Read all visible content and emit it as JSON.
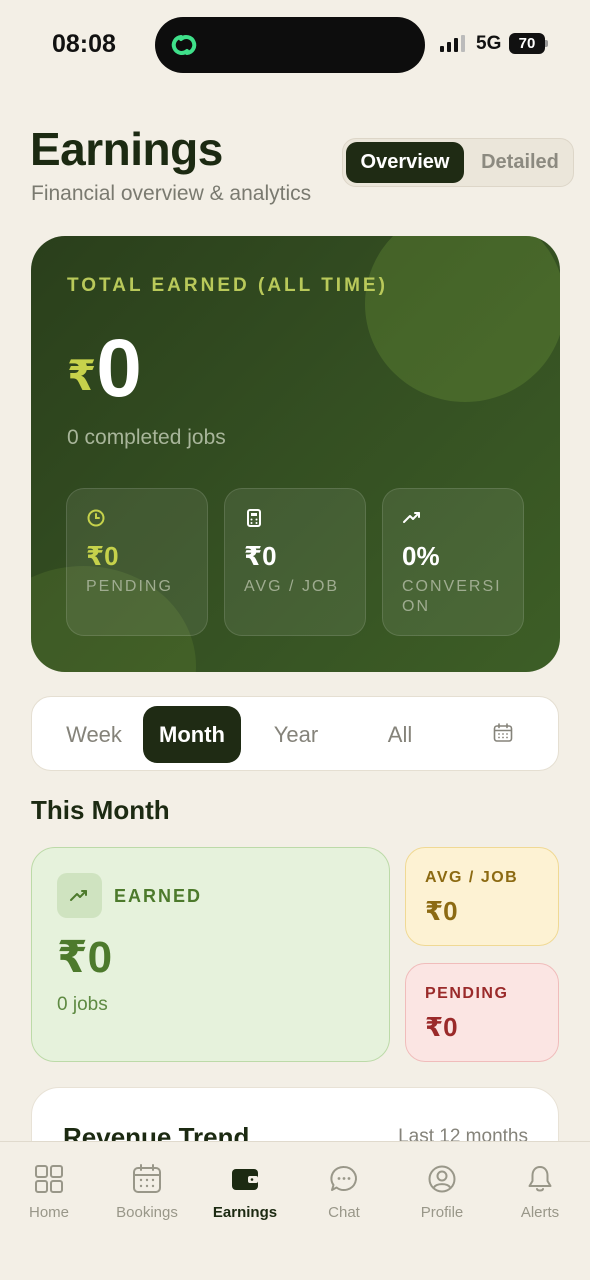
{
  "status_bar": {
    "time": "08:08",
    "network": "5G",
    "battery": "70"
  },
  "header": {
    "title": "Earnings",
    "subtitle": "Financial overview & analytics",
    "view_toggle": [
      "Overview",
      "Detailed"
    ]
  },
  "hero": {
    "label": "TOTAL EARNED (ALL TIME)",
    "currency": "₹",
    "amount": "0",
    "jobs": "0 completed jobs",
    "stats": [
      {
        "icon": "clock-icon",
        "value": "₹0",
        "label": "PENDING"
      },
      {
        "icon": "calculator-icon",
        "value": "₹0",
        "label": "AVG / JOB"
      },
      {
        "icon": "trending-up-icon",
        "value": "0%",
        "label": "CONVERSION"
      }
    ]
  },
  "period_tabs": [
    "Week",
    "Month",
    "Year",
    "All"
  ],
  "period_active": "Month",
  "section_title": "This Month",
  "month": {
    "earned_label": "EARNED",
    "earned_value": "₹0",
    "earned_jobs": "0 jobs",
    "avg_label": "AVG / JOB",
    "avg_value": "₹0",
    "pending_label": "PENDING",
    "pending_value": "₹0"
  },
  "revenue": {
    "title": "Revenue Trend",
    "range": "Last 12 months"
  },
  "nav": [
    "Home",
    "Bookings",
    "Earnings",
    "Chat",
    "Profile",
    "Alerts"
  ],
  "nav_active": "Earnings",
  "colors": {
    "accent_dark": "#1f2b14",
    "hero_green": "#344f22",
    "lime": "#c6d24b",
    "earned_green": "#4d7a2c",
    "pending_red": "#9a2a2a",
    "avg_gold": "#8c6a12"
  }
}
